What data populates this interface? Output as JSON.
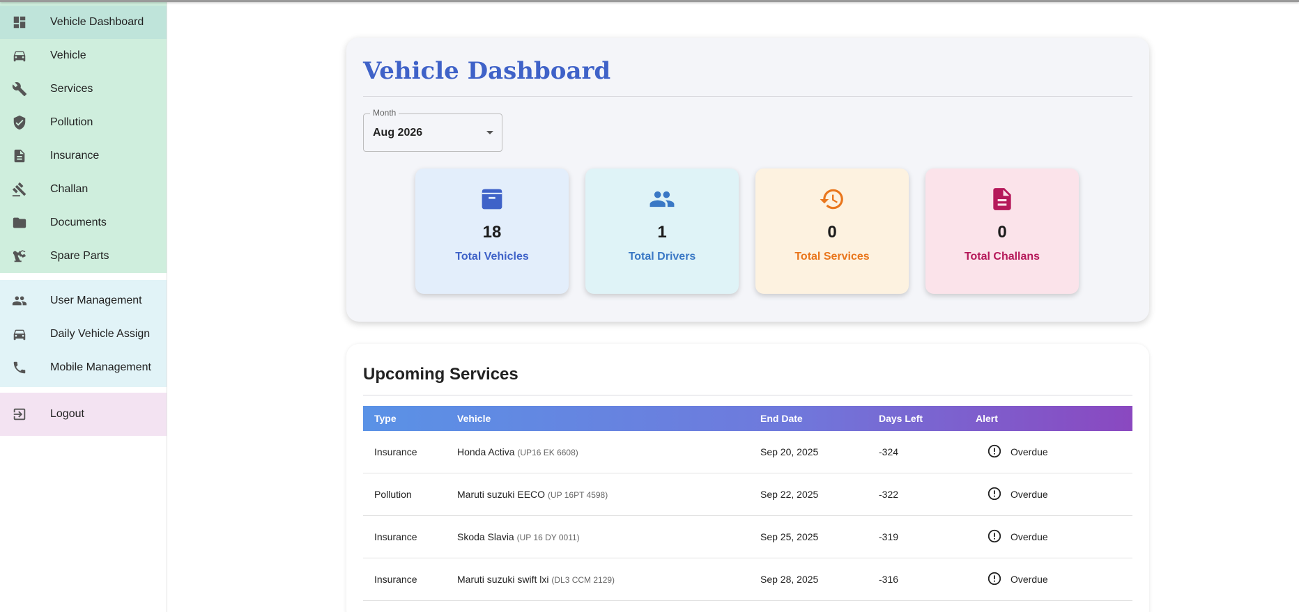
{
  "sidebar": {
    "group1": [
      {
        "label": "Vehicle Dashboard",
        "icon": "dashboard-icon",
        "active": true
      },
      {
        "label": "Vehicle",
        "icon": "car-icon"
      },
      {
        "label": "Services",
        "icon": "wrench-icon"
      },
      {
        "label": "Pollution",
        "icon": "shield-check-icon"
      },
      {
        "label": "Insurance",
        "icon": "document-icon"
      },
      {
        "label": "Challan",
        "icon": "gavel-icon"
      },
      {
        "label": "Documents",
        "icon": "folder-icon"
      },
      {
        "label": "Spare Parts",
        "icon": "robot-arm-icon"
      }
    ],
    "group2": [
      {
        "label": "User Management",
        "icon": "people-icon"
      },
      {
        "label": "Daily Vehicle Assign",
        "icon": "car-icon"
      },
      {
        "label": "Mobile Management",
        "icon": "phone-icon"
      }
    ],
    "logout": {
      "label": "Logout",
      "icon": "logout-icon"
    }
  },
  "dashboard": {
    "title": "Vehicle Dashboard",
    "month_select": {
      "label": "Month",
      "value": "Aug 2026"
    },
    "stats": [
      {
        "value": "18",
        "label": "Total Vehicles",
        "icon": "archive-box-icon",
        "color": "#3f62c8",
        "bg": "#e3eefb"
      },
      {
        "value": "1",
        "label": "Total Drivers",
        "icon": "people-icon",
        "color": "#3a78c5",
        "bg": "#dff3f7"
      },
      {
        "value": "0",
        "label": "Total Services",
        "icon": "history-icon",
        "color": "#e9761c",
        "bg": "#fdf2e0"
      },
      {
        "value": "0",
        "label": "Total Challans",
        "icon": "document-icon",
        "color": "#b5195a",
        "bg": "#fbe3ea"
      }
    ]
  },
  "upcoming": {
    "title": "Upcoming Services",
    "columns": [
      "Type",
      "Vehicle",
      "End Date",
      "Days Left",
      "Alert"
    ],
    "rows": [
      {
        "type": "Insurance",
        "vehicle": "Honda Activa",
        "plate": "(UP16 EK 6608)",
        "end_date": "Sep 20, 2025",
        "days_left": "-324",
        "alert": "Overdue"
      },
      {
        "type": "Pollution",
        "vehicle": "Maruti suzuki EECO",
        "plate": "(UP 16PT 4598)",
        "end_date": "Sep 22, 2025",
        "days_left": "-322",
        "alert": "Overdue"
      },
      {
        "type": "Insurance",
        "vehicle": "Skoda Slavia",
        "plate": "(UP 16 DY 0011)",
        "end_date": "Sep 25, 2025",
        "days_left": "-319",
        "alert": "Overdue"
      },
      {
        "type": "Insurance",
        "vehicle": "Maruti suzuki swift lxi",
        "plate": "(DL3 CCM 2129)",
        "end_date": "Sep 28, 2025",
        "days_left": "-316",
        "alert": "Overdue"
      }
    ]
  }
}
